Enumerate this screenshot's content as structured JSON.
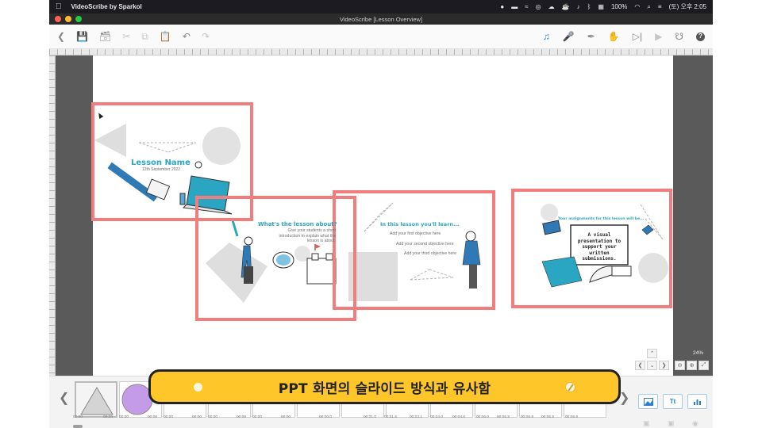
{
  "menubar": {
    "app_name": "VideoScribe by Sparkol",
    "battery": "100%",
    "clock": "(토) 오후 2:05"
  },
  "window": {
    "title": "VideoScribe [Lesson Overview]"
  },
  "slides": {
    "s1": {
      "title": "Lesson Name",
      "date": "12th September 2022"
    },
    "s2": {
      "title": "What's the lesson about?",
      "body": "Give your students a short introduction to explain what the lesson is about."
    },
    "s3": {
      "title": "In this lesson you'll learn...",
      "obj1": "Add your first objective here",
      "obj2": "Add your second objective here",
      "obj3": "Add your third objective here"
    },
    "s4": {
      "title": "Your assignments for this lesson will be...",
      "board": "A visual presentation to support your written submissions."
    }
  },
  "canvas": {
    "zoom": "24%"
  },
  "timeline": {
    "codes": [
      "00:00",
      "00:00",
      "00:00",
      "00:00",
      "00:00",
      "00:00",
      "00:00",
      "00:00",
      "00:00",
      "00:00",
      "00:00.0",
      "00:01.0",
      "00:01.6",
      "00:03.1",
      "00:04.0",
      "00:04.6",
      "00:06.0",
      "00:06.9",
      "00:06.9",
      "00:06.9",
      "00:06.9"
    ],
    "text_tool_label": "Tt"
  },
  "caption": {
    "text": "PPT 화면의 슬라이드 방식과 유사함"
  },
  "colors": {
    "frame": "#f27d7d",
    "accent": "#2aa6c3",
    "caption_bg": "#ffc629"
  }
}
